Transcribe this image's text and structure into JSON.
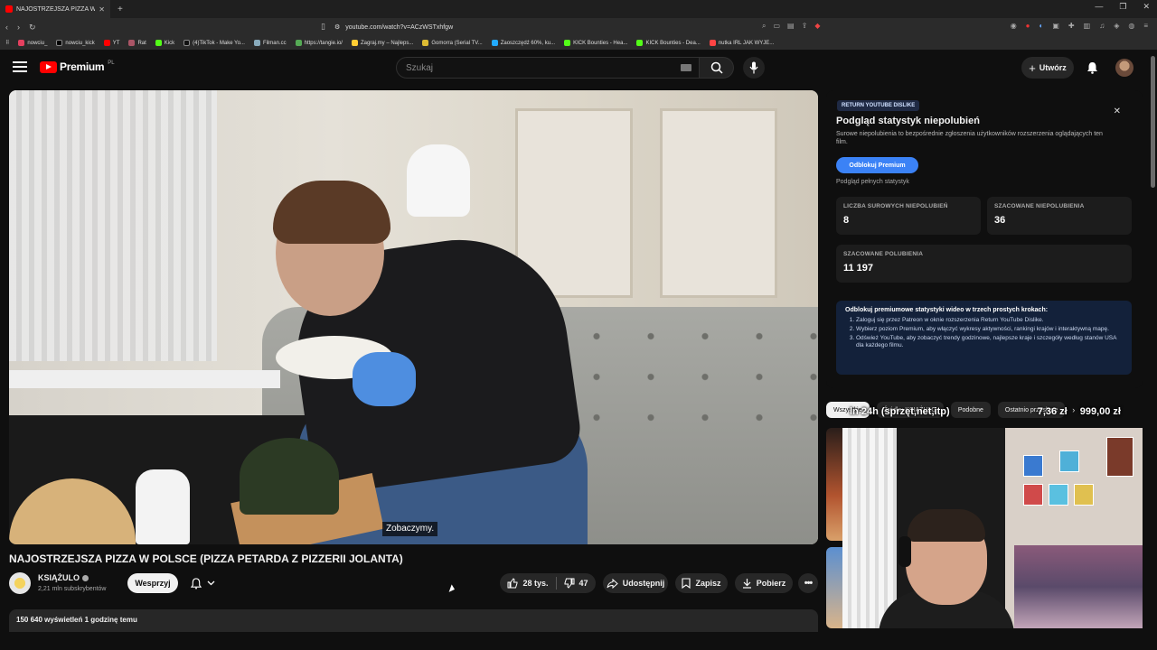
{
  "browser": {
    "tab_title": "NAJOSTRZEJSZA PIZZA W PO",
    "new_tab": "+",
    "url": "youtube.com/watch?v=ACzWSTxhfgw",
    "bookmarks": [
      "nowciu_",
      "nowciu_kick",
      "YT",
      "Rat",
      "Kick",
      "(4)TikTok - Make Yo...",
      "Filman.cc",
      "https://tangie.io/",
      "Zagraj.my – Najleps...",
      "Gomorra (Serial TV...",
      "Zaoszczędź 60%, ku...",
      "KICK Bounties - Hea...",
      "KICK Bounties - Dea...",
      "nutka IRL JAK WYJE..."
    ]
  },
  "header": {
    "logo_word": "Premium",
    "logo_region": "PL",
    "search_placeholder": "Szukaj",
    "create_label": "Utwórz"
  },
  "video": {
    "subtitle": "Zobaczymy.",
    "title": "NAJOSTRZEJSZA PIZZA W POLSCE (PIZZA PETARDA Z PIZZERII JOLANTA)",
    "channel_name": "KSIĄŻULO",
    "subscribers": "2,21 mln subskrybentów",
    "support_label": "Wesprzyj",
    "likes": "28 tys.",
    "dislikes": "47",
    "share_label": "Udostępnij",
    "save_label": "Zapisz",
    "download_label": "Pobierz",
    "views_time": "150 640 wyświetleń  1 godzinę temu"
  },
  "ryd": {
    "badge": "RETURN YOUTUBE DISLIKE",
    "title": "Podgląd statystyk niepolubień",
    "description": "Surowe niepolubienia to bezpośrednie zgłoszenia użytkowników rozszerzenia oglądających ten film.",
    "unlock_label": "Odblokuj Premium",
    "preview_label": "Podgląd pełnych statystyk",
    "stats": [
      {
        "label": "LICZBA SUROWYCH NIEPOLUBIEŃ",
        "value": "8"
      },
      {
        "label": "SZACOWANE NIEPOLUBIENIA",
        "value": "36"
      },
      {
        "label": "SZACOWANE POLUBIENIA",
        "value": "11 197"
      }
    ],
    "steps_heading": "Odblokuj premiumowe statystyki wideo w trzech prostych krokach:",
    "steps": [
      "Zaloguj się przez Patreon w oknie rozszerzenia Return YouTube Dislike.",
      "Wybierz poziom Premium, aby włączyć wykresy aktywności, rankingi krajów i interaktywną mapę.",
      "Odśwież YouTube, aby zobaczyć trendy godzinowe, najlepsze kraje i szczegóły według stanów USA dla każdego filmu."
    ]
  },
  "chips": [
    "Wszystkie",
    "Źródło: KSIĄŻULO",
    "Podobne",
    "Ostatnio przesłane"
  ],
  "overlay": {
    "left": "ln 24h (sprzęt,net,itp)",
    "mid": "7,36 zł",
    "right": "999,00 zł"
  },
  "colors": {
    "background": "#0f0f0f",
    "yt_red": "#ff0000",
    "ryd_blue": "#3b82f6"
  }
}
